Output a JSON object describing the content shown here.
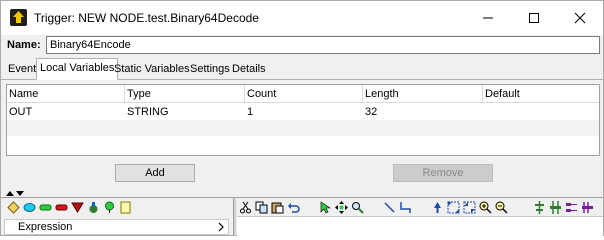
{
  "window": {
    "title": "Trigger:  NEW NODE.test.Binary64Decode",
    "minimize_icon": "minimize-icon",
    "maximize_icon": "maximize-icon",
    "close_icon": "close-icon"
  },
  "name_field": {
    "label": "Name:",
    "value": "Binary64Encode"
  },
  "tabs": [
    {
      "label": "Event",
      "active": false
    },
    {
      "label": "Local Variables",
      "active": true
    },
    {
      "label": "Static Variables",
      "active": false
    },
    {
      "label": "Settings",
      "active": false
    },
    {
      "label": "Details",
      "active": false
    }
  ],
  "table": {
    "columns": [
      "Name",
      "Type",
      "Count",
      "Length",
      "Default"
    ],
    "rows": [
      [
        "OUT",
        "STRING",
        "1",
        "32",
        ""
      ]
    ]
  },
  "buttons": {
    "add": "Add",
    "remove": "Remove"
  },
  "bottom": {
    "expression_label": "Expression",
    "palette_icons": [
      "diamond-icon",
      "ellipse-icon",
      "green-rect-icon",
      "red-rect-icon",
      "triangle-icon",
      "flask-icon",
      "pin-icon",
      "note-icon"
    ],
    "edit_icons": [
      "cut-icon",
      "copy-icon",
      "paste-icon",
      "undo-icon",
      "select-arrow-icon",
      "move-icon",
      "find-icon",
      "line-icon",
      "elbow-line-icon",
      "pointer-icon",
      "fit-icon",
      "shrink-icon",
      "zoom-in-icon",
      "zoom-out-icon",
      "align-icon",
      "distribute-icon",
      "layout-icon",
      "more-icon"
    ]
  },
  "colors": {
    "titlebar": "#ffffff",
    "window_bg": "#f0f0f0"
  }
}
